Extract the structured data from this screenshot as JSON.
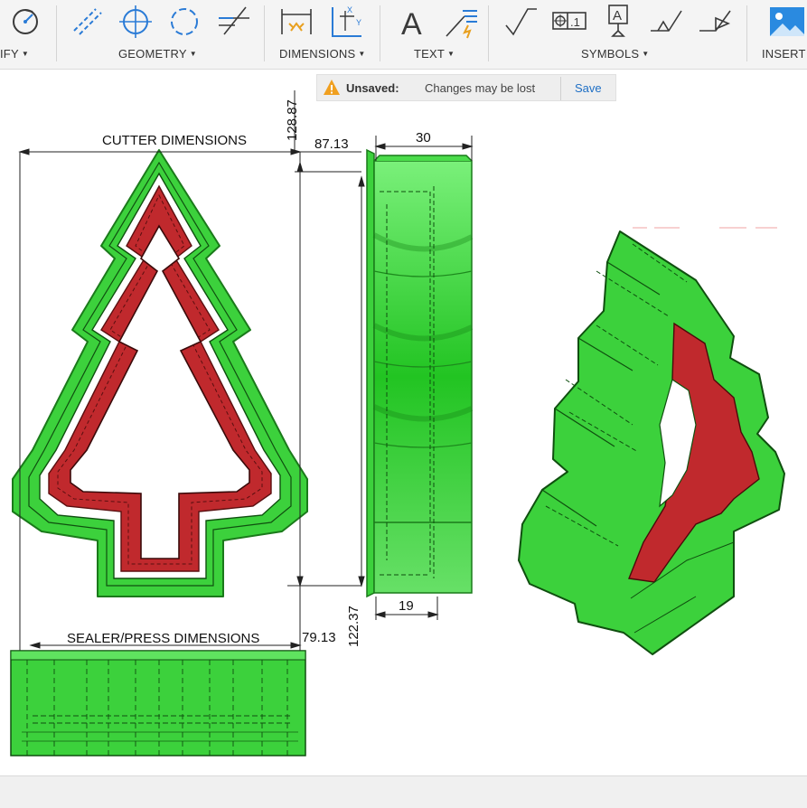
{
  "toolbar": {
    "groups": [
      {
        "label": "IFY",
        "icon": "modify-icon"
      },
      {
        "label": "GEOMETRY",
        "icon": "geometry-icons"
      },
      {
        "label": "DIMENSIONS",
        "icon": "dimension-icons"
      },
      {
        "label": "TEXT",
        "icon": "text-icons"
      },
      {
        "label": "SYMBOLS",
        "icon": "symbol-icons"
      },
      {
        "label": "INSERT",
        "icon": "insert-image-icon"
      }
    ],
    "text_icon_glyph": "A",
    "symbol_datum_glyph": "A",
    "symbol_fcf_glyph": ".1"
  },
  "notice": {
    "label": "Unsaved:",
    "message": "Changes may be lost",
    "save": "Save"
  },
  "drawing": {
    "cutter_title": "CUTTER DIMENSIONS",
    "sealer_title": "SEALER/PRESS DIMENSIONS",
    "dim_128_87": "128.87",
    "dim_87_13": "87.13",
    "dim_30": "30",
    "dim_19": "19",
    "dim_122_37": "122.37",
    "dim_79_13": "79.13"
  },
  "colors": {
    "green": "#3cd13c",
    "dark_green": "#1a7a1a",
    "red": "#c0292d",
    "accent_blue": "#1f6fc5",
    "warning": "#f0a020"
  }
}
